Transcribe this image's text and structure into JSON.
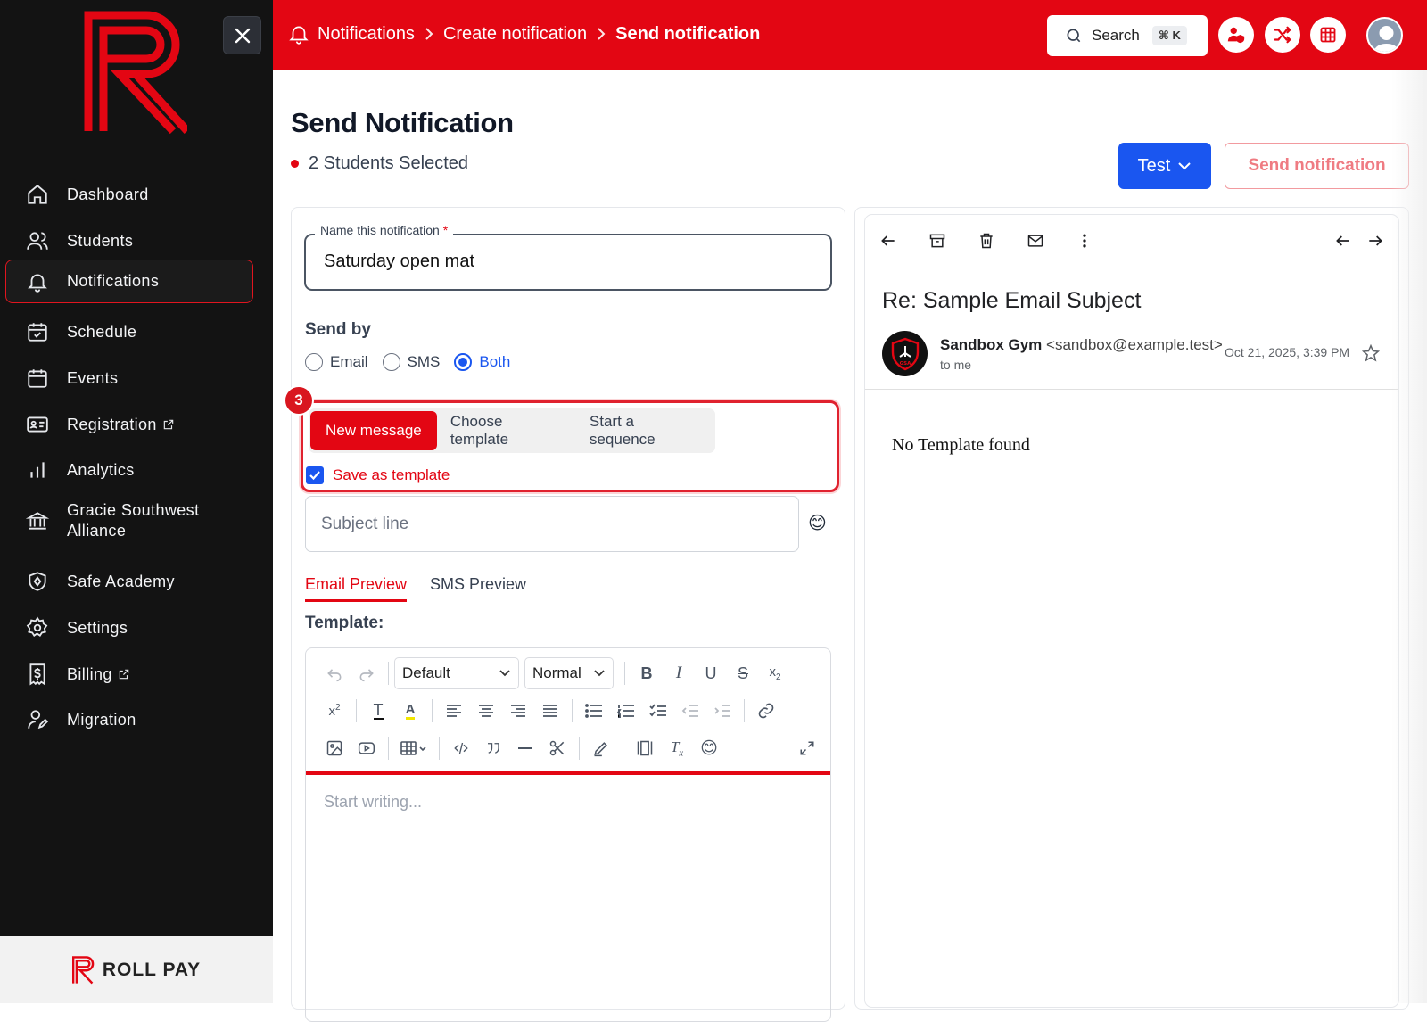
{
  "sidebar": {
    "brand_footer": "ROLL PAY",
    "items": [
      {
        "label": "Dashboard",
        "icon": "home-icon"
      },
      {
        "label": "Students",
        "icon": "users-icon"
      },
      {
        "label": "Notifications",
        "icon": "bell-icon"
      },
      {
        "label": "Schedule",
        "icon": "calendar-check-icon"
      },
      {
        "label": "Events",
        "icon": "calendar-icon"
      },
      {
        "label": "Registration",
        "icon": "id-card-icon"
      },
      {
        "label": "Analytics",
        "icon": "bar-chart-icon"
      },
      {
        "label": "Gracie Southwest Alliance",
        "icon": "bank-icon"
      },
      {
        "label": "Safe Academy",
        "icon": "shield-icon"
      },
      {
        "label": "Settings",
        "icon": "gear-icon"
      },
      {
        "label": "Billing",
        "icon": "dollar-doc-icon"
      },
      {
        "label": "Migration",
        "icon": "user-edit-icon"
      }
    ]
  },
  "header": {
    "crumbs": [
      "Notifications",
      "Create notification",
      "Send notification"
    ],
    "search_label": "Search",
    "search_shortcut": "⌘ K"
  },
  "page": {
    "title": "Send Notification",
    "selected": "2 Students Selected",
    "test_label": "Test",
    "send_label": "Send notification"
  },
  "form": {
    "name_label": "Name this notification",
    "name_required": "*",
    "name_value": "Saturday open mat",
    "send_by_label": "Send by",
    "send_by_options": [
      "Email",
      "SMS",
      "Both"
    ],
    "send_by_selected": "Both",
    "step_number": "3",
    "message_modes": [
      "New message",
      "Choose template",
      "Start a sequence"
    ],
    "save_template_label": "Save as template",
    "subject_placeholder": "Subject line",
    "tabs": [
      "Email Preview",
      "SMS Preview"
    ],
    "template_label": "Template:",
    "font_select": "Default",
    "size_select": "Normal",
    "editor_placeholder": "Start writing..."
  },
  "preview": {
    "subject": "Re: Sample Email Subject",
    "sender_name": "Sandbox Gym",
    "sender_email": "<sandbox@example.test>",
    "to": "to me",
    "date": "Oct 21, 2025, 3:39 PM",
    "avatar_text": "GSA",
    "body": "No Template found"
  },
  "colors": {
    "brand_red": "#e30613",
    "primary_blue": "#1a56f0",
    "sidebar_bg": "#131313"
  }
}
